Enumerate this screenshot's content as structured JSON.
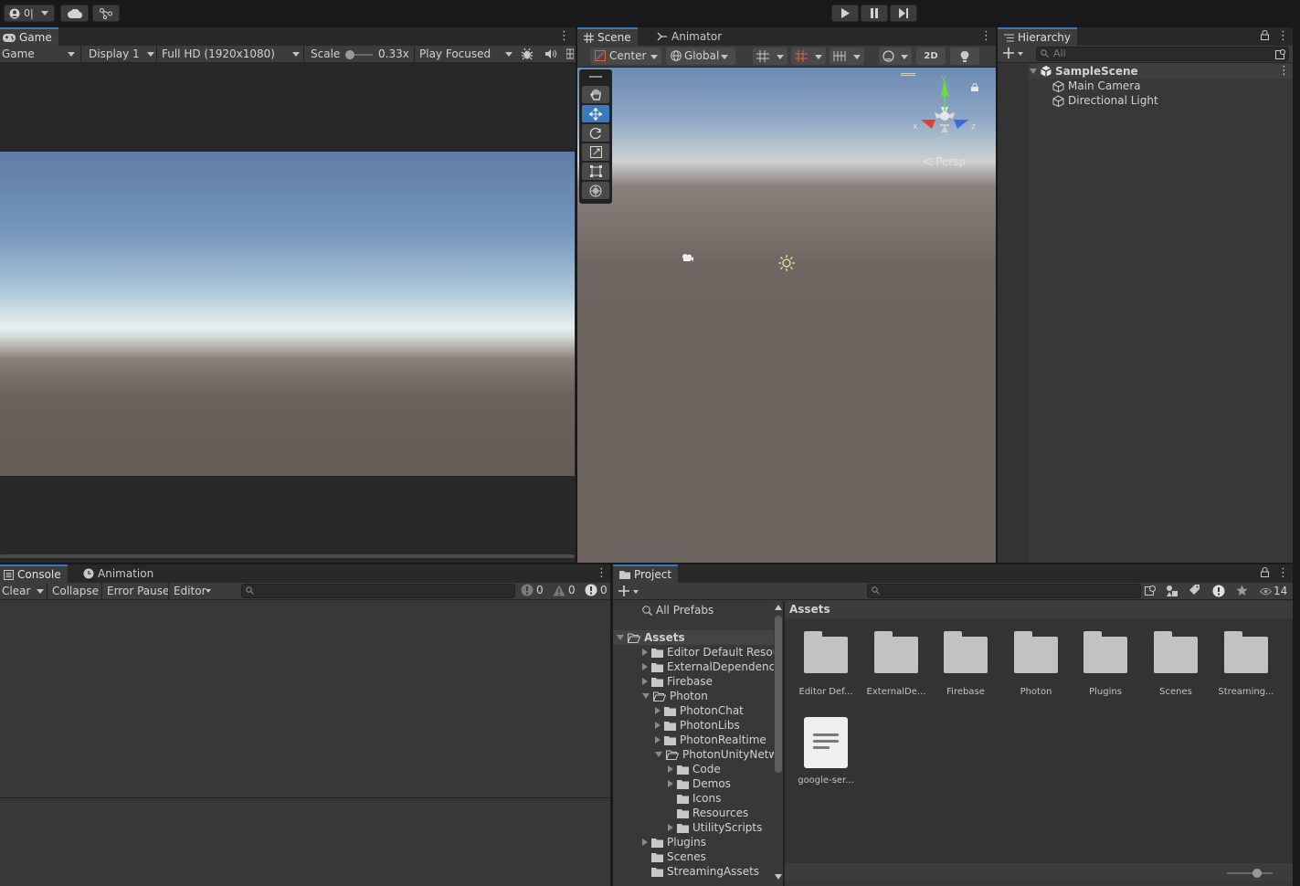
{
  "toolbar": {
    "account_label": "0|",
    "play_label": "▶",
    "pause_label": "❚❚",
    "step_label": "▶|"
  },
  "game": {
    "tab_label": "Game",
    "view_select": "Game",
    "display_select": "Display 1",
    "resolution_select": "Full HD (1920x1080)",
    "scale_label": "Scale",
    "scale_value": "0.33x",
    "play_focused_select": "Play Focused"
  },
  "scene": {
    "tab_label": "Scene",
    "animator_tab_label": "Animator",
    "pivot_select": "Center",
    "space_select": "Global",
    "mode_2d": "2D",
    "persp_label": "Persp",
    "axis_y": "y",
    "axis_x": "x",
    "axis_z": "z"
  },
  "hierarchy": {
    "tab_label": "Hierarchy",
    "search_placeholder": "All",
    "scene_name": "SampleScene",
    "items": [
      "Main Camera",
      "Directional Light"
    ]
  },
  "console": {
    "tab_label": "Console",
    "animation_tab_label": "Animation",
    "clear_label": "Clear",
    "collapse_label": "Collapse",
    "error_pause_label": "Error Pause",
    "editor_label": "Editor",
    "info_count": "0",
    "warning_count": "0",
    "error_count": "0"
  },
  "project": {
    "tab_label": "Project",
    "hidden_count": "14",
    "all_prefabs": "All Prefabs",
    "breadcrumb": "Assets",
    "tree": [
      {
        "label": "Assets",
        "depth": 0,
        "arrow": "open",
        "bold": true
      },
      {
        "label": "Editor Default Resourc",
        "depth": 1,
        "arrow": "closed"
      },
      {
        "label": "ExternalDependencyM",
        "depth": 1,
        "arrow": "closed"
      },
      {
        "label": "Firebase",
        "depth": 1,
        "arrow": "closed"
      },
      {
        "label": "Photon",
        "depth": 1,
        "arrow": "open"
      },
      {
        "label": "PhotonChat",
        "depth": 2,
        "arrow": "closed"
      },
      {
        "label": "PhotonLibs",
        "depth": 2,
        "arrow": "closed"
      },
      {
        "label": "PhotonRealtime",
        "depth": 2,
        "arrow": "closed"
      },
      {
        "label": "PhotonUnityNetwor",
        "depth": 2,
        "arrow": "open"
      },
      {
        "label": "Code",
        "depth": 3,
        "arrow": "closed"
      },
      {
        "label": "Demos",
        "depth": 3,
        "arrow": "closed"
      },
      {
        "label": "Icons",
        "depth": 3,
        "arrow": "none"
      },
      {
        "label": "Resources",
        "depth": 3,
        "arrow": "none"
      },
      {
        "label": "UtilityScripts",
        "depth": 3,
        "arrow": "closed"
      },
      {
        "label": "Plugins",
        "depth": 1,
        "arrow": "closed"
      },
      {
        "label": "Scenes",
        "depth": 1,
        "arrow": "none"
      },
      {
        "label": "StreamingAssets",
        "depth": 1,
        "arrow": "none"
      }
    ],
    "assets": [
      {
        "label": "Editor Def...",
        "kind": "folder"
      },
      {
        "label": "ExternalDe...",
        "kind": "folder"
      },
      {
        "label": "Firebase",
        "kind": "folder"
      },
      {
        "label": "Photon",
        "kind": "folder"
      },
      {
        "label": "Plugins",
        "kind": "folder"
      },
      {
        "label": "Scenes",
        "kind": "folder"
      },
      {
        "label": "Streaming...",
        "kind": "folder"
      },
      {
        "label": "google-ser...",
        "kind": "file"
      }
    ]
  },
  "colors": {
    "accent": "#3a79bb",
    "panel_bg": "#383838",
    "tab_bg": "#282828",
    "sky_top": "#5f7ca8",
    "ground": "#6b625e"
  }
}
